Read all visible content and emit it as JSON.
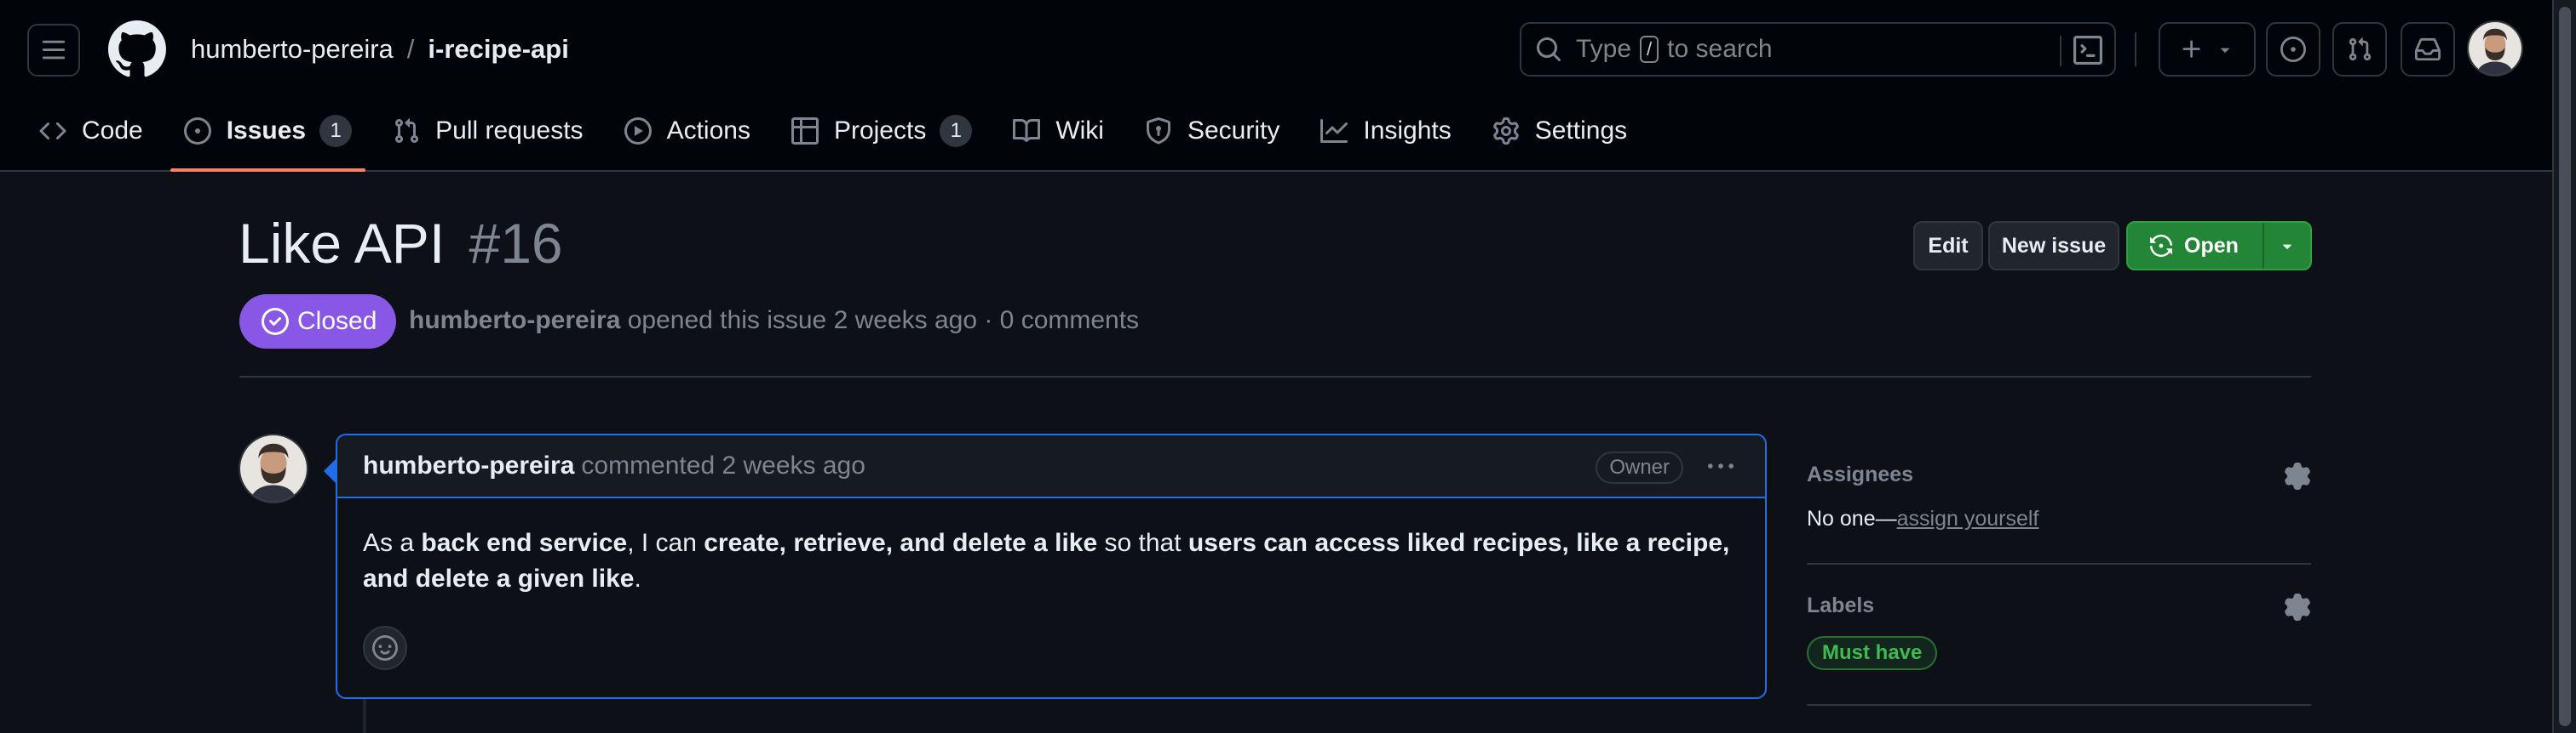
{
  "header": {
    "owner": "humberto-pereira",
    "separator": "/",
    "repo": "i-recipe-api",
    "search": {
      "prefix": "Type",
      "key": "/",
      "suffix": "to search"
    }
  },
  "tabs": [
    {
      "label": "Code",
      "icon": "code-icon"
    },
    {
      "label": "Issues",
      "icon": "issue-opened-icon",
      "count": "1",
      "active": true
    },
    {
      "label": "Pull requests",
      "icon": "git-pull-request-icon"
    },
    {
      "label": "Actions",
      "icon": "play-icon"
    },
    {
      "label": "Projects",
      "icon": "table-icon",
      "count": "1"
    },
    {
      "label": "Wiki",
      "icon": "book-icon"
    },
    {
      "label": "Security",
      "icon": "shield-icon"
    },
    {
      "label": "Insights",
      "icon": "graph-icon"
    },
    {
      "label": "Settings",
      "icon": "gear-icon"
    }
  ],
  "issue": {
    "title": "Like API",
    "number": "#16",
    "actions": {
      "edit": "Edit",
      "new_issue": "New issue",
      "open": "Open"
    },
    "state": "Closed",
    "author": "humberto-pereira",
    "meta_text": "opened this issue 2 weeks ago · 0 comments"
  },
  "comment": {
    "author": "humberto-pereira",
    "action": "commented 2 weeks ago",
    "role": "Owner",
    "body": [
      {
        "t": "As a ",
        "b": false
      },
      {
        "t": "back end service",
        "b": true
      },
      {
        "t": ", I can ",
        "b": false
      },
      {
        "t": "create, retrieve, and delete a like",
        "b": true
      },
      {
        "t": " so that ",
        "b": false
      },
      {
        "t": "users can access liked recipes, like a recipe, and delete a given like",
        "b": true
      },
      {
        "t": ".",
        "b": false
      }
    ]
  },
  "sidebar": {
    "assignees": {
      "heading": "Assignees",
      "prefix": "No one—",
      "link": "assign yourself"
    },
    "labels": {
      "heading": "Labels",
      "items": [
        {
          "name": "Must have",
          "color": "#3fb950"
        }
      ]
    }
  },
  "colors": {
    "accent_tab": "#f78166",
    "closed": "#8957e5",
    "open_button": "#238636",
    "focus_border": "#1f6feb"
  }
}
